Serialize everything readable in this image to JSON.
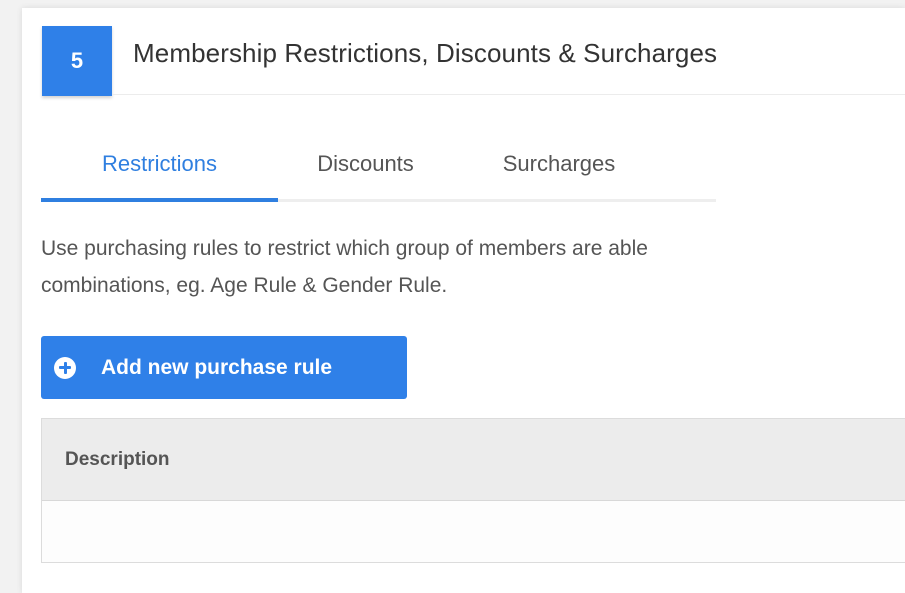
{
  "section": {
    "step_number": "5",
    "title": "Membership Restrictions, Discounts & Surcharges"
  },
  "tabs": [
    {
      "label": "Restrictions",
      "active": true
    },
    {
      "label": "Discounts",
      "active": false
    },
    {
      "label": "Surcharges",
      "active": false
    }
  ],
  "description": {
    "line1": "Use purchasing rules to restrict which group of members are able",
    "line2": "combinations, eg. Age Rule & Gender Rule."
  },
  "add_button": {
    "label": "Add new purchase rule",
    "icon": "plus-circle-icon"
  },
  "table": {
    "columns": [
      "Description"
    ],
    "rows": []
  },
  "colors": {
    "accent": "#2f80e8",
    "tab_active": "#2f7fe0",
    "table_header_bg": "#ececec"
  }
}
